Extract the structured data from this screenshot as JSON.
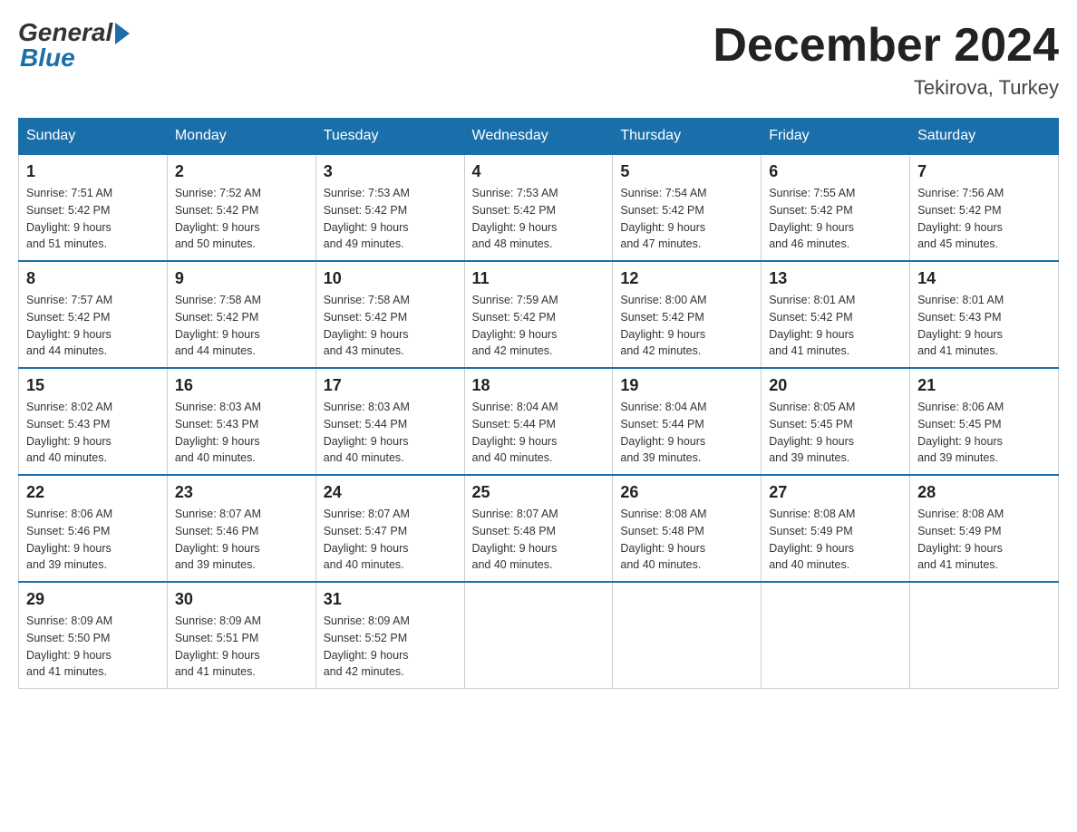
{
  "header": {
    "logo_general": "General",
    "logo_blue": "Blue",
    "month_title": "December 2024",
    "location": "Tekirova, Turkey"
  },
  "weekdays": [
    "Sunday",
    "Monday",
    "Tuesday",
    "Wednesday",
    "Thursday",
    "Friday",
    "Saturday"
  ],
  "weeks": [
    [
      {
        "day": "1",
        "sunrise": "7:51 AM",
        "sunset": "5:42 PM",
        "daylight": "9 hours and 51 minutes."
      },
      {
        "day": "2",
        "sunrise": "7:52 AM",
        "sunset": "5:42 PM",
        "daylight": "9 hours and 50 minutes."
      },
      {
        "day": "3",
        "sunrise": "7:53 AM",
        "sunset": "5:42 PM",
        "daylight": "9 hours and 49 minutes."
      },
      {
        "day": "4",
        "sunrise": "7:53 AM",
        "sunset": "5:42 PM",
        "daylight": "9 hours and 48 minutes."
      },
      {
        "day": "5",
        "sunrise": "7:54 AM",
        "sunset": "5:42 PM",
        "daylight": "9 hours and 47 minutes."
      },
      {
        "day": "6",
        "sunrise": "7:55 AM",
        "sunset": "5:42 PM",
        "daylight": "9 hours and 46 minutes."
      },
      {
        "day": "7",
        "sunrise": "7:56 AM",
        "sunset": "5:42 PM",
        "daylight": "9 hours and 45 minutes."
      }
    ],
    [
      {
        "day": "8",
        "sunrise": "7:57 AM",
        "sunset": "5:42 PM",
        "daylight": "9 hours and 44 minutes."
      },
      {
        "day": "9",
        "sunrise": "7:58 AM",
        "sunset": "5:42 PM",
        "daylight": "9 hours and 44 minutes."
      },
      {
        "day": "10",
        "sunrise": "7:58 AM",
        "sunset": "5:42 PM",
        "daylight": "9 hours and 43 minutes."
      },
      {
        "day": "11",
        "sunrise": "7:59 AM",
        "sunset": "5:42 PM",
        "daylight": "9 hours and 42 minutes."
      },
      {
        "day": "12",
        "sunrise": "8:00 AM",
        "sunset": "5:42 PM",
        "daylight": "9 hours and 42 minutes."
      },
      {
        "day": "13",
        "sunrise": "8:01 AM",
        "sunset": "5:42 PM",
        "daylight": "9 hours and 41 minutes."
      },
      {
        "day": "14",
        "sunrise": "8:01 AM",
        "sunset": "5:43 PM",
        "daylight": "9 hours and 41 minutes."
      }
    ],
    [
      {
        "day": "15",
        "sunrise": "8:02 AM",
        "sunset": "5:43 PM",
        "daylight": "9 hours and 40 minutes."
      },
      {
        "day": "16",
        "sunrise": "8:03 AM",
        "sunset": "5:43 PM",
        "daylight": "9 hours and 40 minutes."
      },
      {
        "day": "17",
        "sunrise": "8:03 AM",
        "sunset": "5:44 PM",
        "daylight": "9 hours and 40 minutes."
      },
      {
        "day": "18",
        "sunrise": "8:04 AM",
        "sunset": "5:44 PM",
        "daylight": "9 hours and 40 minutes."
      },
      {
        "day": "19",
        "sunrise": "8:04 AM",
        "sunset": "5:44 PM",
        "daylight": "9 hours and 39 minutes."
      },
      {
        "day": "20",
        "sunrise": "8:05 AM",
        "sunset": "5:45 PM",
        "daylight": "9 hours and 39 minutes."
      },
      {
        "day": "21",
        "sunrise": "8:06 AM",
        "sunset": "5:45 PM",
        "daylight": "9 hours and 39 minutes."
      }
    ],
    [
      {
        "day": "22",
        "sunrise": "8:06 AM",
        "sunset": "5:46 PM",
        "daylight": "9 hours and 39 minutes."
      },
      {
        "day": "23",
        "sunrise": "8:07 AM",
        "sunset": "5:46 PM",
        "daylight": "9 hours and 39 minutes."
      },
      {
        "day": "24",
        "sunrise": "8:07 AM",
        "sunset": "5:47 PM",
        "daylight": "9 hours and 40 minutes."
      },
      {
        "day": "25",
        "sunrise": "8:07 AM",
        "sunset": "5:48 PM",
        "daylight": "9 hours and 40 minutes."
      },
      {
        "day": "26",
        "sunrise": "8:08 AM",
        "sunset": "5:48 PM",
        "daylight": "9 hours and 40 minutes."
      },
      {
        "day": "27",
        "sunrise": "8:08 AM",
        "sunset": "5:49 PM",
        "daylight": "9 hours and 40 minutes."
      },
      {
        "day": "28",
        "sunrise": "8:08 AM",
        "sunset": "5:49 PM",
        "daylight": "9 hours and 41 minutes."
      }
    ],
    [
      {
        "day": "29",
        "sunrise": "8:09 AM",
        "sunset": "5:50 PM",
        "daylight": "9 hours and 41 minutes."
      },
      {
        "day": "30",
        "sunrise": "8:09 AM",
        "sunset": "5:51 PM",
        "daylight": "9 hours and 41 minutes."
      },
      {
        "day": "31",
        "sunrise": "8:09 AM",
        "sunset": "5:52 PM",
        "daylight": "9 hours and 42 minutes."
      },
      null,
      null,
      null,
      null
    ]
  ],
  "cell_labels": {
    "sunrise": "Sunrise: ",
    "sunset": "Sunset: ",
    "daylight": "Daylight: "
  }
}
